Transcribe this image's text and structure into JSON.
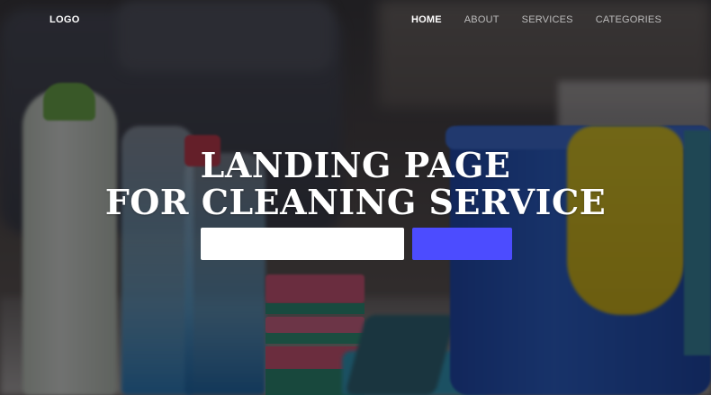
{
  "nav": {
    "logo": "LOGO",
    "items": [
      {
        "label": "HOME",
        "active": true
      },
      {
        "label": "ABOUT",
        "active": false
      },
      {
        "label": "SERVICES",
        "active": false
      },
      {
        "label": "CATEGORIES",
        "active": false
      }
    ]
  },
  "hero": {
    "title_line1": "LANDING PAGE",
    "title_line2": "FOR CLEANING SERVICE"
  },
  "form": {
    "email_value": "",
    "button_label": ""
  },
  "colors": {
    "accent": "#4c4cff",
    "nav_active": "#ffffff",
    "nav_inactive": "#bdbdbd"
  }
}
